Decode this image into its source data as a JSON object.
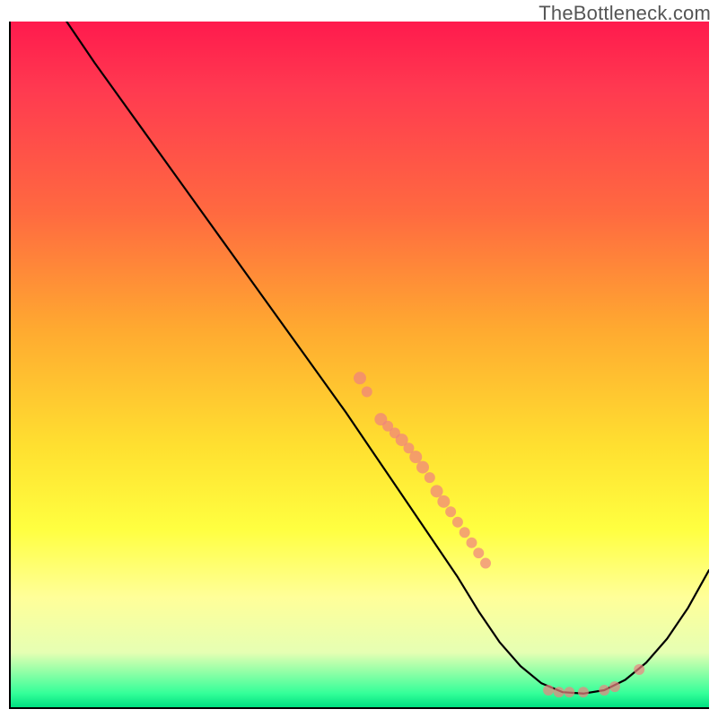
{
  "watermark": "TheBottleneck.com",
  "chart_data": {
    "type": "line",
    "title": "",
    "xlabel": "",
    "ylabel": "",
    "xlim": [
      0,
      100
    ],
    "ylim": [
      0,
      100
    ],
    "grid": false,
    "legend": false,
    "colors": {
      "curve": "#000000",
      "points": "#f08080",
      "points_alpha": 0.7
    },
    "curve_xy": [
      [
        8,
        100
      ],
      [
        12,
        94
      ],
      [
        18,
        85.5
      ],
      [
        24,
        77
      ],
      [
        30,
        68.5
      ],
      [
        36,
        60
      ],
      [
        42,
        51.5
      ],
      [
        48,
        43
      ],
      [
        52,
        37
      ],
      [
        56,
        31
      ],
      [
        60,
        25
      ],
      [
        64,
        19
      ],
      [
        67,
        14
      ],
      [
        70,
        9.5
      ],
      [
        73,
        6
      ],
      [
        76,
        3.5
      ],
      [
        79,
        2.2
      ],
      [
        82,
        2
      ],
      [
        85,
        2.5
      ],
      [
        88,
        4
      ],
      [
        91,
        6.5
      ],
      [
        94,
        10
      ],
      [
        97,
        14.5
      ],
      [
        100,
        20
      ]
    ],
    "scatter_points": [
      {
        "x": 50,
        "y": 48,
        "r": 7
      },
      {
        "x": 51,
        "y": 46,
        "r": 6
      },
      {
        "x": 53,
        "y": 42,
        "r": 7
      },
      {
        "x": 54,
        "y": 41,
        "r": 6
      },
      {
        "x": 55,
        "y": 40,
        "r": 6
      },
      {
        "x": 56,
        "y": 39,
        "r": 7
      },
      {
        "x": 57,
        "y": 37.8,
        "r": 6
      },
      {
        "x": 58,
        "y": 36.5,
        "r": 7
      },
      {
        "x": 59,
        "y": 35,
        "r": 7
      },
      {
        "x": 60,
        "y": 33.5,
        "r": 6
      },
      {
        "x": 61,
        "y": 31.5,
        "r": 7
      },
      {
        "x": 62,
        "y": 30,
        "r": 7
      },
      {
        "x": 63,
        "y": 28.5,
        "r": 6
      },
      {
        "x": 64,
        "y": 27,
        "r": 6
      },
      {
        "x": 65,
        "y": 25.5,
        "r": 6
      },
      {
        "x": 66,
        "y": 24,
        "r": 6
      },
      {
        "x": 67,
        "y": 22.5,
        "r": 6
      },
      {
        "x": 68,
        "y": 21,
        "r": 6
      },
      {
        "x": 77,
        "y": 2.5,
        "r": 6
      },
      {
        "x": 78.5,
        "y": 2.2,
        "r": 6
      },
      {
        "x": 80,
        "y": 2.2,
        "r": 6
      },
      {
        "x": 82,
        "y": 2.2,
        "r": 6
      },
      {
        "x": 85,
        "y": 2.5,
        "r": 6
      },
      {
        "x": 86.5,
        "y": 3,
        "r": 6
      },
      {
        "x": 90,
        "y": 5.5,
        "r": 6
      }
    ]
  }
}
